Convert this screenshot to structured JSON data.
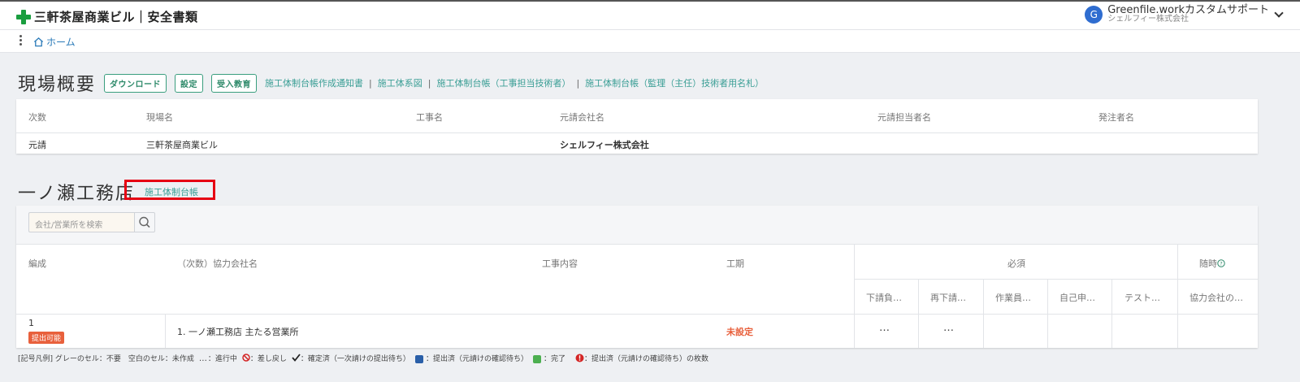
{
  "header": {
    "app_title": "三軒茶屋商業ビル｜安全書類",
    "user_initial": "G",
    "user_name": "Greenfile.workカスタムサポート",
    "user_company": "シェルフィー株式会社"
  },
  "breadcrumb": {
    "home_label": "ホーム"
  },
  "site_overview": {
    "title": "現場概要",
    "buttons": [
      "ダウンロード",
      "設定",
      "受入教育"
    ],
    "links": [
      "施工体制台帳作成通知書",
      "施工体系図",
      "施工体制台帳（工事担当技術者）",
      "施工体制台帳（監理（主任）技術者用名札）"
    ],
    "columns": [
      "次数",
      "現場名",
      "工事名",
      "元請会社名",
      "元請担当者名",
      "発注者名"
    ],
    "row": [
      "元請",
      "三軒茶屋商業ビル",
      "",
      "シェルフィー株式会社",
      "",
      ""
    ]
  },
  "company_section": {
    "title": "一ノ瀬工務店",
    "ledger_link": "施工体制台帳",
    "search_placeholder": "会社/営業所を検索",
    "headers": {
      "org": "編成",
      "partner": "（次数）協力会社名",
      "content": "工事内容",
      "period": "工期",
      "required_group": "必須",
      "optional_group": "随時",
      "required_cols": [
        "下請負…",
        "再下請…",
        "作業員…",
        "自己申…",
        "テスト…"
      ],
      "optional_cols": [
        "協力会社の…"
      ]
    },
    "row": {
      "org_number": "1",
      "status_badge": "提出可能",
      "partner_name": "1. 一ノ瀬工務店 主たる営業所",
      "period": "未設定",
      "cell1": "…",
      "cell2": "…"
    }
  },
  "legend": {
    "prefix": "[記号凡例] グレーのセル：不要　空白のセル：未作成",
    "in_progress": "：進行中",
    "returned": "：差し戻し",
    "confirmed": "：確定済（一次請けの提出待ち）",
    "submitted": "：提出済（元請けの確認待ち）",
    "complete": "：完了",
    "count": "：提出済（元請けの確認待ち）の枚数"
  },
  "colors": {
    "accent_green": "#3a9e7e",
    "link": "#3a9e95",
    "badge": "#e8603c",
    "period_red": "#e8603c",
    "highlight": "#e60012"
  }
}
